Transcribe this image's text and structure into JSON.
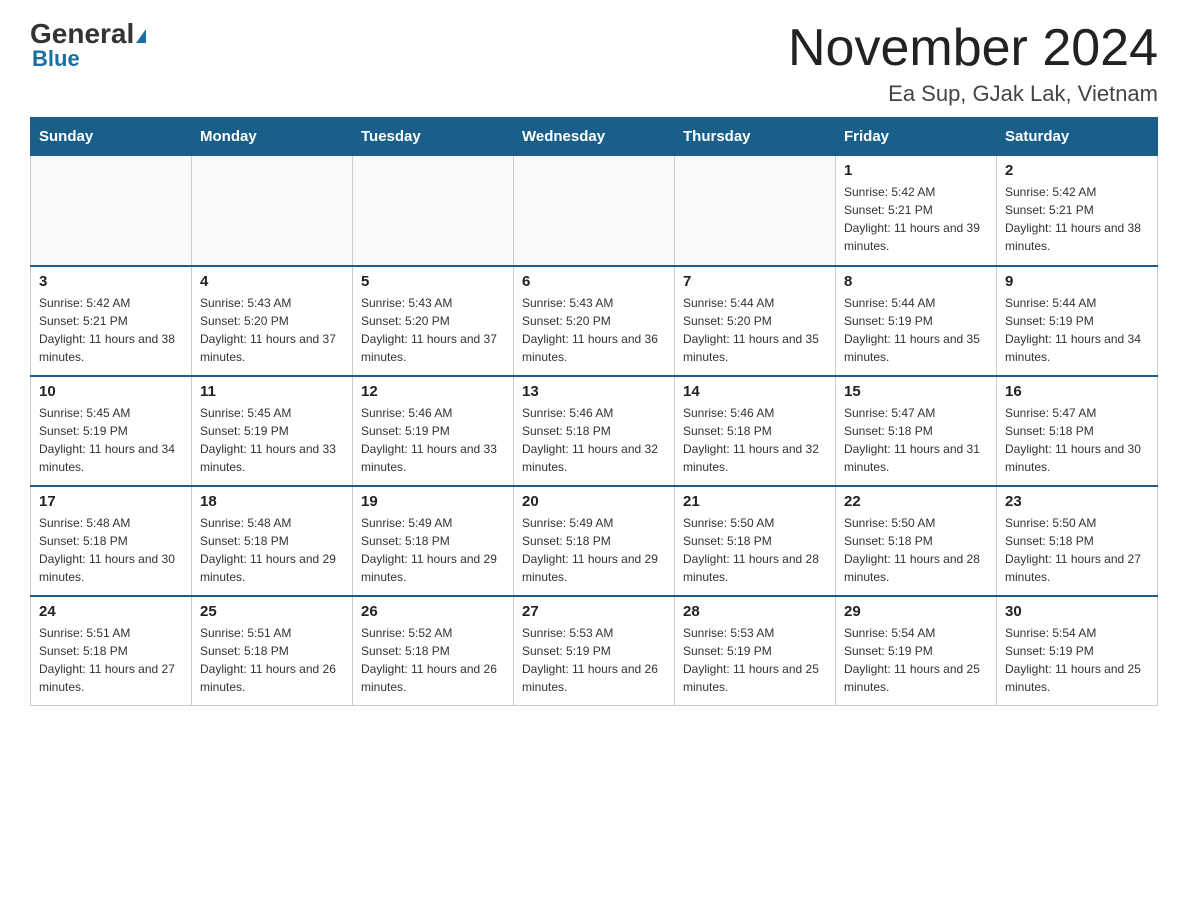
{
  "header": {
    "logo_general": "General",
    "logo_blue": "Blue",
    "month_title": "November 2024",
    "location": "Ea Sup, GJak Lak, Vietnam"
  },
  "weekdays": [
    "Sunday",
    "Monday",
    "Tuesday",
    "Wednesday",
    "Thursday",
    "Friday",
    "Saturday"
  ],
  "weeks": [
    [
      {
        "day": "",
        "sunrise": "",
        "sunset": "",
        "daylight": ""
      },
      {
        "day": "",
        "sunrise": "",
        "sunset": "",
        "daylight": ""
      },
      {
        "day": "",
        "sunrise": "",
        "sunset": "",
        "daylight": ""
      },
      {
        "day": "",
        "sunrise": "",
        "sunset": "",
        "daylight": ""
      },
      {
        "day": "",
        "sunrise": "",
        "sunset": "",
        "daylight": ""
      },
      {
        "day": "1",
        "sunrise": "Sunrise: 5:42 AM",
        "sunset": "Sunset: 5:21 PM",
        "daylight": "Daylight: 11 hours and 39 minutes."
      },
      {
        "day": "2",
        "sunrise": "Sunrise: 5:42 AM",
        "sunset": "Sunset: 5:21 PM",
        "daylight": "Daylight: 11 hours and 38 minutes."
      }
    ],
    [
      {
        "day": "3",
        "sunrise": "Sunrise: 5:42 AM",
        "sunset": "Sunset: 5:21 PM",
        "daylight": "Daylight: 11 hours and 38 minutes."
      },
      {
        "day": "4",
        "sunrise": "Sunrise: 5:43 AM",
        "sunset": "Sunset: 5:20 PM",
        "daylight": "Daylight: 11 hours and 37 minutes."
      },
      {
        "day": "5",
        "sunrise": "Sunrise: 5:43 AM",
        "sunset": "Sunset: 5:20 PM",
        "daylight": "Daylight: 11 hours and 37 minutes."
      },
      {
        "day": "6",
        "sunrise": "Sunrise: 5:43 AM",
        "sunset": "Sunset: 5:20 PM",
        "daylight": "Daylight: 11 hours and 36 minutes."
      },
      {
        "day": "7",
        "sunrise": "Sunrise: 5:44 AM",
        "sunset": "Sunset: 5:20 PM",
        "daylight": "Daylight: 11 hours and 35 minutes."
      },
      {
        "day": "8",
        "sunrise": "Sunrise: 5:44 AM",
        "sunset": "Sunset: 5:19 PM",
        "daylight": "Daylight: 11 hours and 35 minutes."
      },
      {
        "day": "9",
        "sunrise": "Sunrise: 5:44 AM",
        "sunset": "Sunset: 5:19 PM",
        "daylight": "Daylight: 11 hours and 34 minutes."
      }
    ],
    [
      {
        "day": "10",
        "sunrise": "Sunrise: 5:45 AM",
        "sunset": "Sunset: 5:19 PM",
        "daylight": "Daylight: 11 hours and 34 minutes."
      },
      {
        "day": "11",
        "sunrise": "Sunrise: 5:45 AM",
        "sunset": "Sunset: 5:19 PM",
        "daylight": "Daylight: 11 hours and 33 minutes."
      },
      {
        "day": "12",
        "sunrise": "Sunrise: 5:46 AM",
        "sunset": "Sunset: 5:19 PM",
        "daylight": "Daylight: 11 hours and 33 minutes."
      },
      {
        "day": "13",
        "sunrise": "Sunrise: 5:46 AM",
        "sunset": "Sunset: 5:18 PM",
        "daylight": "Daylight: 11 hours and 32 minutes."
      },
      {
        "day": "14",
        "sunrise": "Sunrise: 5:46 AM",
        "sunset": "Sunset: 5:18 PM",
        "daylight": "Daylight: 11 hours and 32 minutes."
      },
      {
        "day": "15",
        "sunrise": "Sunrise: 5:47 AM",
        "sunset": "Sunset: 5:18 PM",
        "daylight": "Daylight: 11 hours and 31 minutes."
      },
      {
        "day": "16",
        "sunrise": "Sunrise: 5:47 AM",
        "sunset": "Sunset: 5:18 PM",
        "daylight": "Daylight: 11 hours and 30 minutes."
      }
    ],
    [
      {
        "day": "17",
        "sunrise": "Sunrise: 5:48 AM",
        "sunset": "Sunset: 5:18 PM",
        "daylight": "Daylight: 11 hours and 30 minutes."
      },
      {
        "day": "18",
        "sunrise": "Sunrise: 5:48 AM",
        "sunset": "Sunset: 5:18 PM",
        "daylight": "Daylight: 11 hours and 29 minutes."
      },
      {
        "day": "19",
        "sunrise": "Sunrise: 5:49 AM",
        "sunset": "Sunset: 5:18 PM",
        "daylight": "Daylight: 11 hours and 29 minutes."
      },
      {
        "day": "20",
        "sunrise": "Sunrise: 5:49 AM",
        "sunset": "Sunset: 5:18 PM",
        "daylight": "Daylight: 11 hours and 29 minutes."
      },
      {
        "day": "21",
        "sunrise": "Sunrise: 5:50 AM",
        "sunset": "Sunset: 5:18 PM",
        "daylight": "Daylight: 11 hours and 28 minutes."
      },
      {
        "day": "22",
        "sunrise": "Sunrise: 5:50 AM",
        "sunset": "Sunset: 5:18 PM",
        "daylight": "Daylight: 11 hours and 28 minutes."
      },
      {
        "day": "23",
        "sunrise": "Sunrise: 5:50 AM",
        "sunset": "Sunset: 5:18 PM",
        "daylight": "Daylight: 11 hours and 27 minutes."
      }
    ],
    [
      {
        "day": "24",
        "sunrise": "Sunrise: 5:51 AM",
        "sunset": "Sunset: 5:18 PM",
        "daylight": "Daylight: 11 hours and 27 minutes."
      },
      {
        "day": "25",
        "sunrise": "Sunrise: 5:51 AM",
        "sunset": "Sunset: 5:18 PM",
        "daylight": "Daylight: 11 hours and 26 minutes."
      },
      {
        "day": "26",
        "sunrise": "Sunrise: 5:52 AM",
        "sunset": "Sunset: 5:18 PM",
        "daylight": "Daylight: 11 hours and 26 minutes."
      },
      {
        "day": "27",
        "sunrise": "Sunrise: 5:53 AM",
        "sunset": "Sunset: 5:19 PM",
        "daylight": "Daylight: 11 hours and 26 minutes."
      },
      {
        "day": "28",
        "sunrise": "Sunrise: 5:53 AM",
        "sunset": "Sunset: 5:19 PM",
        "daylight": "Daylight: 11 hours and 25 minutes."
      },
      {
        "day": "29",
        "sunrise": "Sunrise: 5:54 AM",
        "sunset": "Sunset: 5:19 PM",
        "daylight": "Daylight: 11 hours and 25 minutes."
      },
      {
        "day": "30",
        "sunrise": "Sunrise: 5:54 AM",
        "sunset": "Sunset: 5:19 PM",
        "daylight": "Daylight: 11 hours and 25 minutes."
      }
    ]
  ]
}
